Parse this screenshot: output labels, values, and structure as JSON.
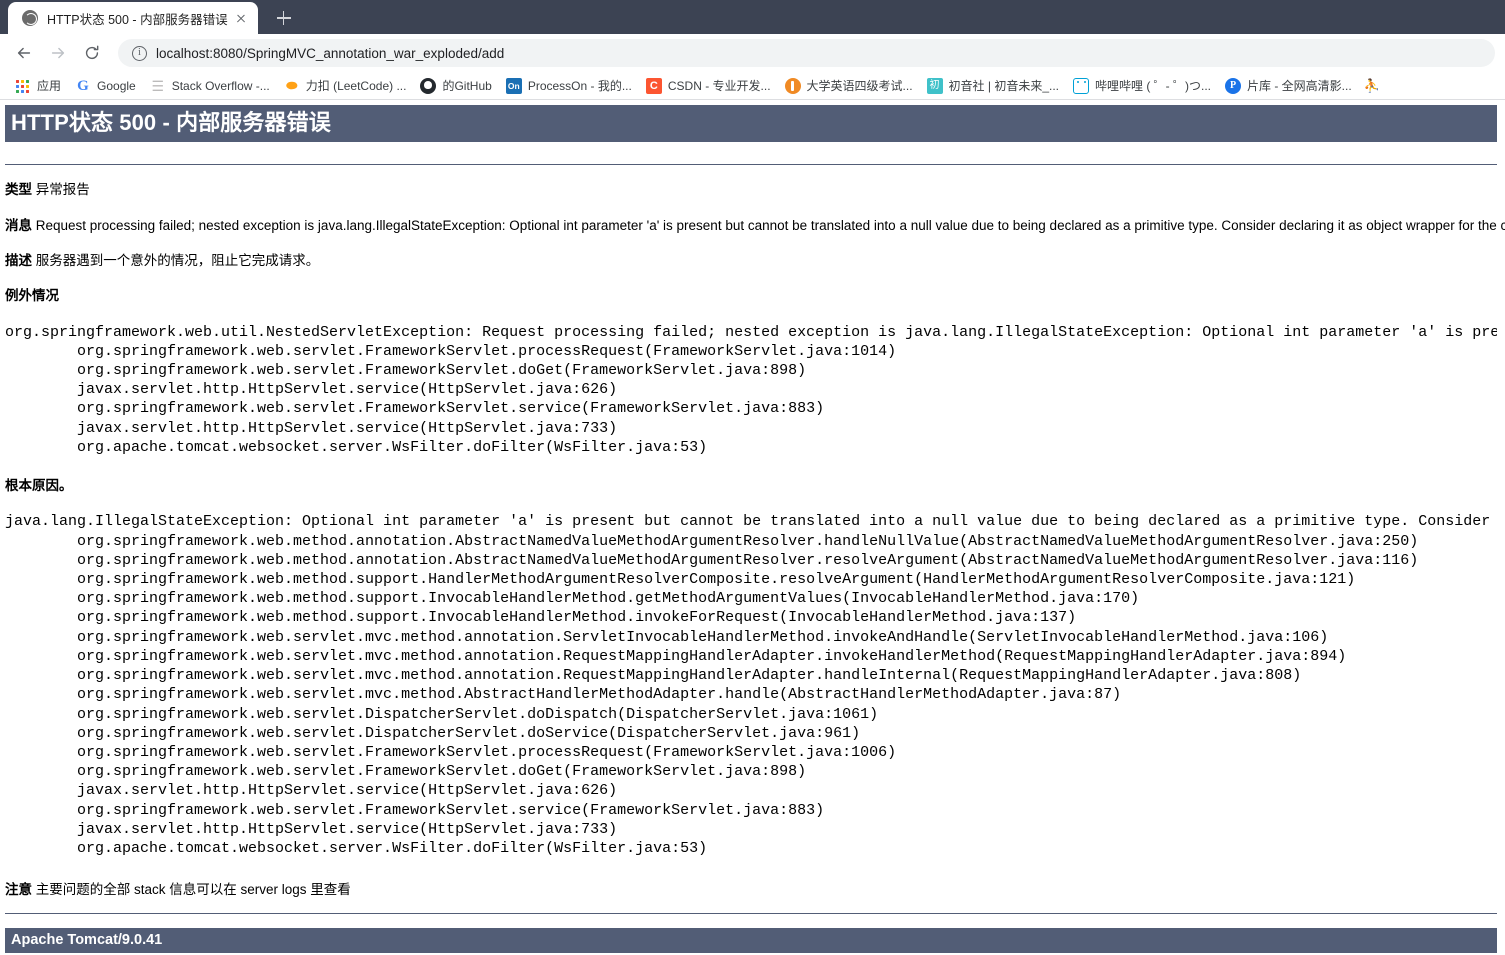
{
  "browser": {
    "tab": {
      "title": "HTTP状态 500 - 内部服务器错误",
      "favicon_name": "globe-favicon",
      "close_label": "×"
    },
    "newtab_label": "+",
    "nav": {
      "back_label": "←",
      "forward_label": "→",
      "reload_label": "⟳"
    },
    "omnibox": {
      "url": "localhost:8080/SpringMVC_annotation_war_exploded/add",
      "security_icon": "info-circle-icon"
    },
    "bookmarks": [
      {
        "icon": "apps-grid-icon",
        "label": "应用"
      },
      {
        "icon": "google-icon",
        "label": "Google"
      },
      {
        "icon": "stackoverflow-icon",
        "label": "Stack Overflow -..."
      },
      {
        "icon": "leetcode-icon",
        "label": "力扣 (LeetCode) ..."
      },
      {
        "icon": "github-icon",
        "label": "的GitHub"
      },
      {
        "icon": "processon-icon",
        "label": "ProcessOn - 我的..."
      },
      {
        "icon": "csdn-icon",
        "label": "CSDN - 专业开发..."
      },
      {
        "icon": "cet-icon",
        "label": "大学英语四级考试..."
      },
      {
        "icon": "mikufans-icon",
        "label": "初音社 | 初音未来_..."
      },
      {
        "icon": "bilibili-icon",
        "label": "哔哩哔哩 ( ゜- ゜)つ..."
      },
      {
        "icon": "pianku-icon",
        "label": "片库 - 全网高清影..."
      }
    ],
    "bookmarks_overflow_icon": "person-icon"
  },
  "error_page": {
    "title": "HTTP状态 500 - 内部服务器错误",
    "rows": [
      {
        "label": "类型",
        "value": "异常报告"
      },
      {
        "label": "消息",
        "value": "Request processing failed; nested exception is java.lang.IllegalStateException: Optional int parameter 'a' is present but cannot be translated into a null value due to being declared as a primitive type. Consider declaring it as object wrapper for the corresponding primitive type."
      },
      {
        "label": "描述",
        "value": "服务器遇到一个意外的情况，阻止它完成请求。"
      }
    ],
    "exception_heading": "例外情况",
    "exception_trace": "org.springframework.web.util.NestedServletException: Request processing failed; nested exception is java.lang.IllegalStateException: Optional int parameter 'a' is pres\n        org.springframework.web.servlet.FrameworkServlet.processRequest(FrameworkServlet.java:1014)\n        org.springframework.web.servlet.FrameworkServlet.doGet(FrameworkServlet.java:898)\n        javax.servlet.http.HttpServlet.service(HttpServlet.java:626)\n        org.springframework.web.servlet.FrameworkServlet.service(FrameworkServlet.java:883)\n        javax.servlet.http.HttpServlet.service(HttpServlet.java:733)\n        org.apache.tomcat.websocket.server.WsFilter.doFilter(WsFilter.java:53)",
    "root_cause_heading": "根本原因。",
    "root_cause_trace": "java.lang.IllegalStateException: Optional int parameter 'a' is present but cannot be translated into a null value due to being declared as a primitive type. Consider d\n        org.springframework.web.method.annotation.AbstractNamedValueMethodArgumentResolver.handleNullValue(AbstractNamedValueMethodArgumentResolver.java:250)\n        org.springframework.web.method.annotation.AbstractNamedValueMethodArgumentResolver.resolveArgument(AbstractNamedValueMethodArgumentResolver.java:116)\n        org.springframework.web.method.support.HandlerMethodArgumentResolverComposite.resolveArgument(HandlerMethodArgumentResolverComposite.java:121)\n        org.springframework.web.method.support.InvocableHandlerMethod.getMethodArgumentValues(InvocableHandlerMethod.java:170)\n        org.springframework.web.method.support.InvocableHandlerMethod.invokeForRequest(InvocableHandlerMethod.java:137)\n        org.springframework.web.servlet.mvc.method.annotation.ServletInvocableHandlerMethod.invokeAndHandle(ServletInvocableHandlerMethod.java:106)\n        org.springframework.web.servlet.mvc.method.annotation.RequestMappingHandlerAdapter.invokeHandlerMethod(RequestMappingHandlerAdapter.java:894)\n        org.springframework.web.servlet.mvc.method.annotation.RequestMappingHandlerAdapter.handleInternal(RequestMappingHandlerAdapter.java:808)\n        org.springframework.web.servlet.mvc.method.AbstractHandlerMethodAdapter.handle(AbstractHandlerMethodAdapter.java:87)\n        org.springframework.web.servlet.DispatcherServlet.doDispatch(DispatcherServlet.java:1061)\n        org.springframework.web.servlet.DispatcherServlet.doService(DispatcherServlet.java:961)\n        org.springframework.web.servlet.FrameworkServlet.processRequest(FrameworkServlet.java:1006)\n        org.springframework.web.servlet.FrameworkServlet.doGet(FrameworkServlet.java:898)\n        javax.servlet.http.HttpServlet.service(HttpServlet.java:626)\n        org.springframework.web.servlet.FrameworkServlet.service(FrameworkServlet.java:883)\n        javax.servlet.http.HttpServlet.service(HttpServlet.java:733)\n        org.apache.tomcat.websocket.server.WsFilter.doFilter(WsFilter.java:53)",
    "note_label": "注意",
    "note_text": "主要问题的全部 stack 信息可以在 server logs 里查看",
    "footer": "Apache Tomcat/9.0.41",
    "colors": {
      "header_bg": "#525D76",
      "header_fg": "#FFFFFF",
      "body_bg": "#FFFFFF",
      "body_fg": "#000000"
    }
  }
}
